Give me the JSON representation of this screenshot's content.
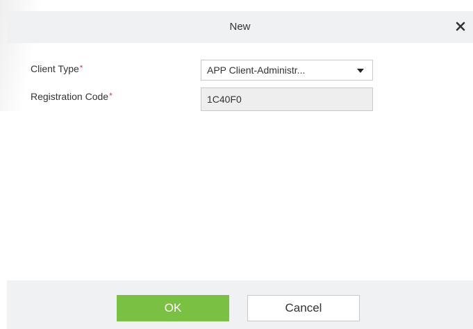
{
  "dialog": {
    "title": "New",
    "close_icon": "close-icon"
  },
  "form": {
    "client_type": {
      "label": "Client Type",
      "required_mark": "*",
      "value": "APP Client-Administr..."
    },
    "registration_code": {
      "label": "Registration Code",
      "required_mark": "*",
      "value": "1C40F0"
    }
  },
  "footer": {
    "ok_label": "OK",
    "cancel_label": "Cancel"
  },
  "colors": {
    "ok_button": "#7ac143",
    "required_mark": "#e53935",
    "header_footer_bg": "#f0f1f3"
  }
}
